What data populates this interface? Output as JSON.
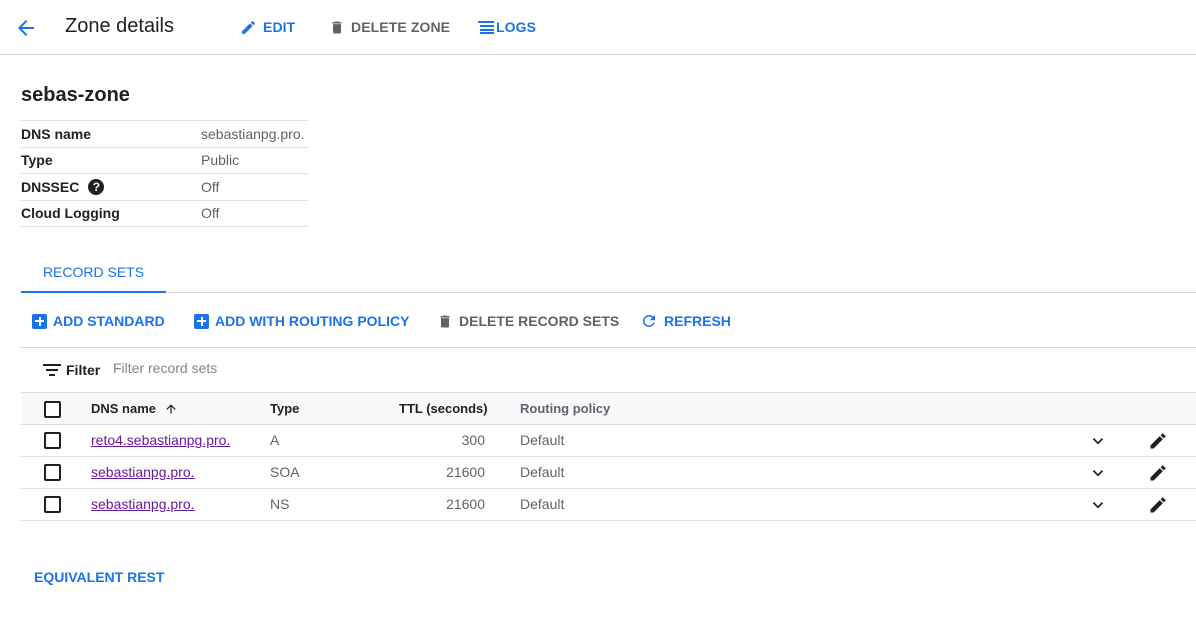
{
  "header": {
    "title": "Zone details",
    "edit_label": "EDIT",
    "delete_zone_label": "DELETE ZONE",
    "logs_label": "LOGS"
  },
  "zone": {
    "name": "sebas-zone",
    "details": [
      {
        "key": "DNS name",
        "value": "sebastianpg.pro."
      },
      {
        "key": "Type",
        "value": "Public"
      },
      {
        "key": "DNSSEC",
        "value": "Off"
      },
      {
        "key": "Cloud Logging",
        "value": "Off"
      }
    ]
  },
  "tabs": [
    {
      "label": "RECORD SETS"
    }
  ],
  "actions": {
    "add_standard": "ADD STANDARD",
    "add_routing": "ADD WITH ROUTING POLICY",
    "delete_records": "DELETE RECORD SETS",
    "refresh": "REFRESH"
  },
  "filter": {
    "label": "Filter",
    "placeholder": "Filter record sets"
  },
  "table": {
    "columns": {
      "dns_name": "DNS name",
      "type": "Type",
      "ttl": "TTL (seconds)",
      "routing": "Routing policy"
    },
    "rows": [
      {
        "dns_name": "reto4.sebastianpg.pro.",
        "type": "A",
        "ttl": "300",
        "routing": "Default"
      },
      {
        "dns_name": "sebastianpg.pro.",
        "type": "SOA",
        "ttl": "21600",
        "routing": "Default"
      },
      {
        "dns_name": "sebastianpg.pro.",
        "type": "NS",
        "ttl": "21600",
        "routing": "Default"
      }
    ]
  },
  "footer": {
    "equivalent_rest": "EQUIVALENT REST"
  },
  "colors": {
    "accent": "#1a73e8",
    "visited_link": "#6a1b9a",
    "muted_text": "#5f6368",
    "divider": "#dadce0"
  }
}
